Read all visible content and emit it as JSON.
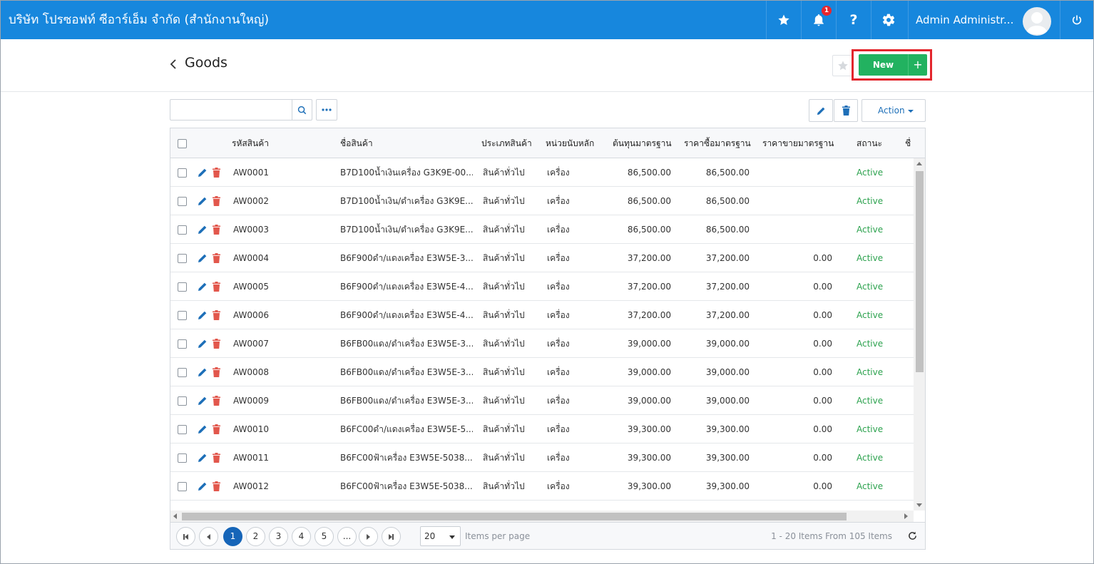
{
  "topbar": {
    "company": "บริษัท โปรซอฟท์ ซีอาร์เอ็ม จำกัด (สำนักงานใหญ่)",
    "notification_count": "1",
    "user_name": "Admin Administr...",
    "accent_color": "#1787dd"
  },
  "header": {
    "title": "Goods",
    "new_label": "New",
    "new_plus": "+"
  },
  "toolbar": {
    "search_placeholder": "",
    "action_label": "Action"
  },
  "table": {
    "columns": {
      "code": "รหัสสินค้า",
      "name": "ชื่อสินค้า",
      "type": "ประเภทสินค้า",
      "unit": "หน่วยนับหลัก",
      "cost": "ต้นทุนมาตรฐาน",
      "buy": "ราคาซื้อมาตรฐาน",
      "sell": "ราคาขายมาตรฐาน",
      "status": "สถานะ",
      "extra": "ชื่"
    },
    "rows": [
      {
        "code": "AW0001",
        "name": "B7D100น้ำเงินเครื่อง G3K9E-00...",
        "type": "สินค้าทั่วไป",
        "unit": "เครื่อง",
        "cost": "86,500.00",
        "buy": "86,500.00",
        "sell": "",
        "status": "Active"
      },
      {
        "code": "AW0002",
        "name": "B7D100น้ำเงิน/ดำเครื่อง G3K9E...",
        "type": "สินค้าทั่วไป",
        "unit": "เครื่อง",
        "cost": "86,500.00",
        "buy": "86,500.00",
        "sell": "",
        "status": "Active"
      },
      {
        "code": "AW0003",
        "name": "B7D100น้ำเงิน/ดำเครื่อง G3K9E...",
        "type": "สินค้าทั่วไป",
        "unit": "เครื่อง",
        "cost": "86,500.00",
        "buy": "86,500.00",
        "sell": "",
        "status": "Active"
      },
      {
        "code": "AW0004",
        "name": "B6F900ดำ/แดงเครื่อง E3W5E-3...",
        "type": "สินค้าทั่วไป",
        "unit": "เครื่อง",
        "cost": "37,200.00",
        "buy": "37,200.00",
        "sell": "0.00",
        "status": "Active"
      },
      {
        "code": "AW0005",
        "name": "B6F900ดำ/แดงเครื่อง E3W5E-4...",
        "type": "สินค้าทั่วไป",
        "unit": "เครื่อง",
        "cost": "37,200.00",
        "buy": "37,200.00",
        "sell": "0.00",
        "status": "Active"
      },
      {
        "code": "AW0006",
        "name": "B6F900ดำ/แดงเครื่อง E3W5E-4...",
        "type": "สินค้าทั่วไป",
        "unit": "เครื่อง",
        "cost": "37,200.00",
        "buy": "37,200.00",
        "sell": "0.00",
        "status": "Active"
      },
      {
        "code": "AW0007",
        "name": "B6FB00แดง/ดำเครื่อง E3W5E-3...",
        "type": "สินค้าทั่วไป",
        "unit": "เครื่อง",
        "cost": "39,000.00",
        "buy": "39,000.00",
        "sell": "0.00",
        "status": "Active"
      },
      {
        "code": "AW0008",
        "name": "B6FB00แดง/ดำเครื่อง E3W5E-3...",
        "type": "สินค้าทั่วไป",
        "unit": "เครื่อง",
        "cost": "39,000.00",
        "buy": "39,000.00",
        "sell": "0.00",
        "status": "Active"
      },
      {
        "code": "AW0009",
        "name": "B6FB00แดง/ดำเครื่อง E3W5E-3...",
        "type": "สินค้าทั่วไป",
        "unit": "เครื่อง",
        "cost": "39,000.00",
        "buy": "39,000.00",
        "sell": "0.00",
        "status": "Active"
      },
      {
        "code": "AW0010",
        "name": "B6FC00ดำ/แดงเครื่อง E3W5E-5...",
        "type": "สินค้าทั่วไป",
        "unit": "เครื่อง",
        "cost": "39,300.00",
        "buy": "39,300.00",
        "sell": "0.00",
        "status": "Active"
      },
      {
        "code": "AW0011",
        "name": "B6FC00ฟ้าเครื่อง E3W5E-5038...",
        "type": "สินค้าทั่วไป",
        "unit": "เครื่อง",
        "cost": "39,300.00",
        "buy": "39,300.00",
        "sell": "0.00",
        "status": "Active"
      },
      {
        "code": "AW0012",
        "name": "B6FC00ฟ้าเครื่อง E3W5E-5038...",
        "type": "สินค้าทั่วไป",
        "unit": "เครื่อง",
        "cost": "39,300.00",
        "buy": "39,300.00",
        "sell": "0.00",
        "status": "Active"
      }
    ]
  },
  "pager": {
    "pages": [
      "1",
      "2",
      "3",
      "4",
      "5",
      "..."
    ],
    "current_page": "1",
    "page_size": "20",
    "per_page_label": "Items per page",
    "info": "1 - 20 Items From 105 Items"
  }
}
